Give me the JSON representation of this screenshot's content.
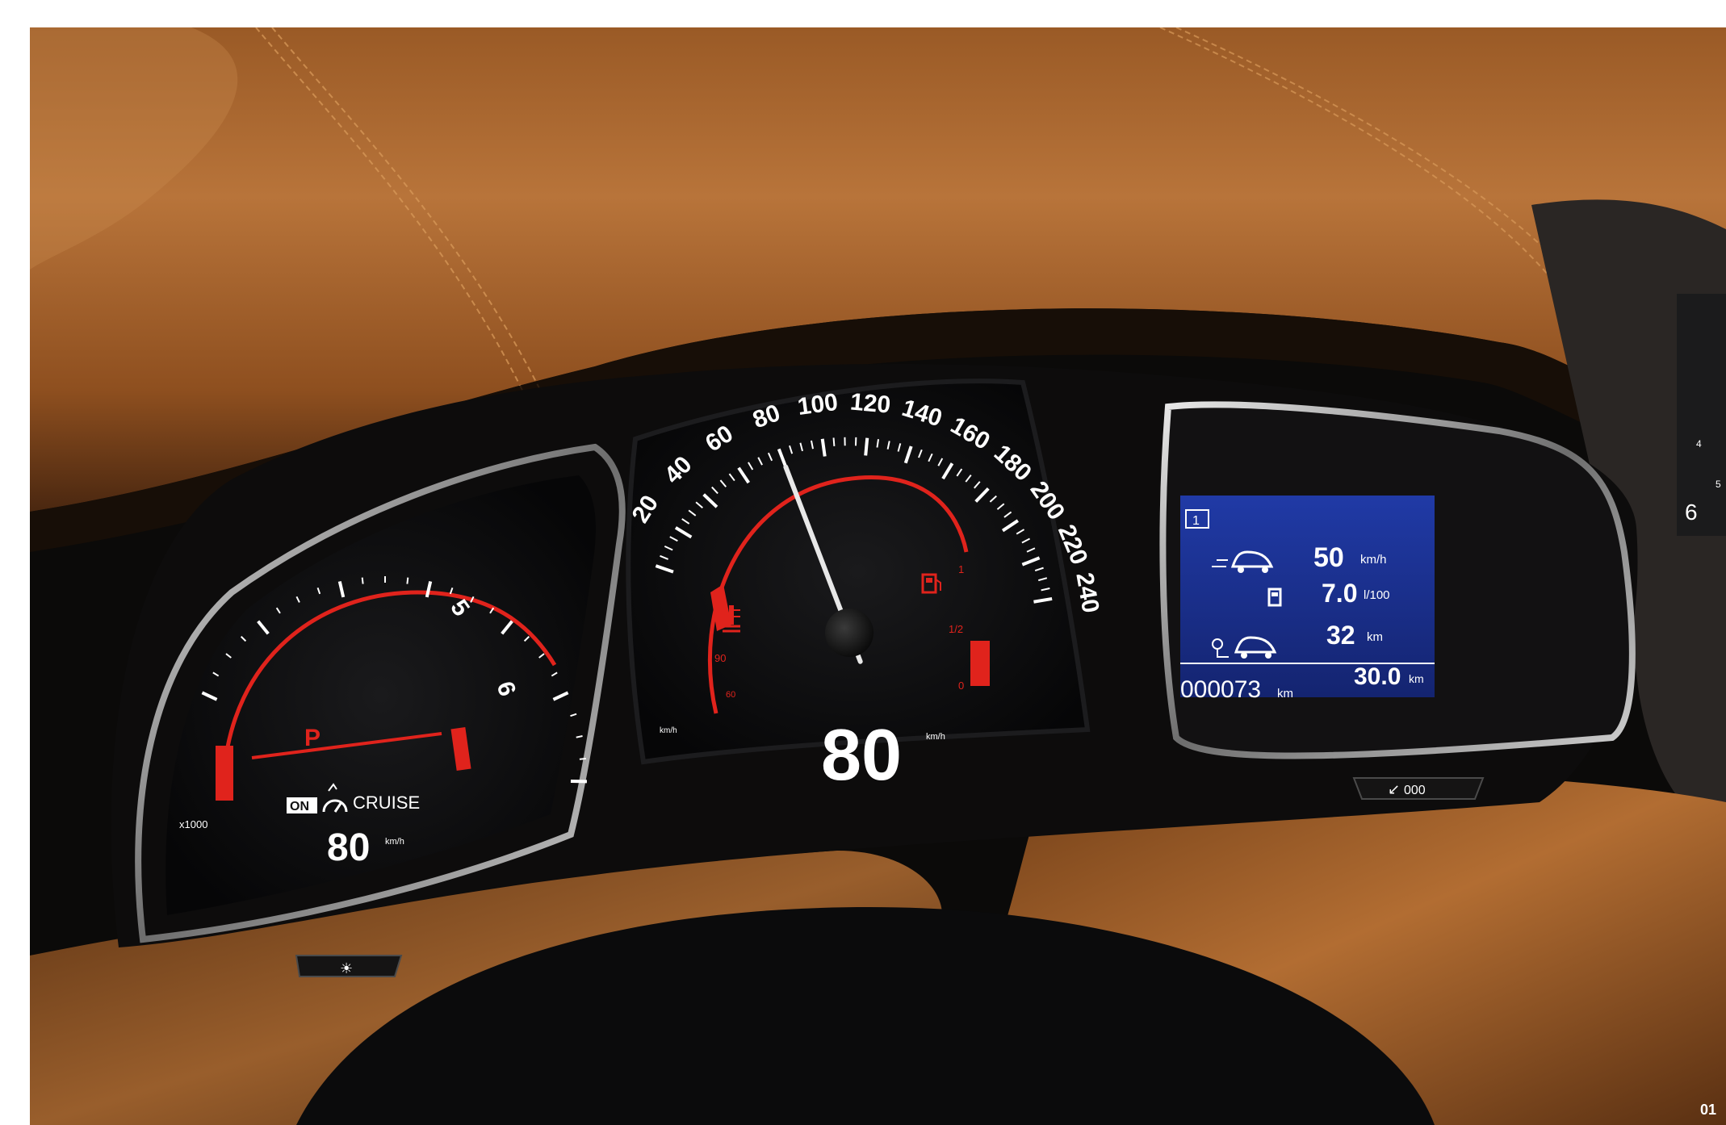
{
  "page": {
    "number": "01"
  },
  "tachometer": {
    "labels": [
      "5",
      "6"
    ],
    "multiplier": "x1000",
    "gear": "P",
    "cruise": {
      "state": "ON",
      "label": "CRUISE",
      "speed": "80",
      "unit": "km/h"
    }
  },
  "speedometer": {
    "labels": [
      "20",
      "40",
      "60",
      "80",
      "100",
      "120",
      "140",
      "160",
      "180",
      "200",
      "220",
      "240"
    ],
    "unit": "km/h",
    "needle_value_kmh": 80,
    "digital_speed": "80",
    "digital_unit": "km/h",
    "temp_marks": [
      "90",
      "60"
    ],
    "fuel_marks": [
      "1",
      "1/2",
      "0"
    ]
  },
  "trip_display": {
    "trip_index": "1",
    "rows": [
      {
        "value": "50",
        "unit": "km/h"
      },
      {
        "value": "7.0",
        "unit": "l/100"
      },
      {
        "value": "32",
        "unit": "km"
      }
    ],
    "odometer": "000073",
    "odometer_unit": "km",
    "trip_distance": "30.0",
    "trip_distance_unit": "km"
  },
  "controls": {
    "reset_button_label": "000",
    "side_dial_labels": [
      "4",
      "5",
      "6"
    ]
  },
  "colors": {
    "leather": "#a8652a",
    "gauge_red": "#e0231c",
    "lcd_blue": "#1a2f8c",
    "trim": "#0d0c0c"
  }
}
